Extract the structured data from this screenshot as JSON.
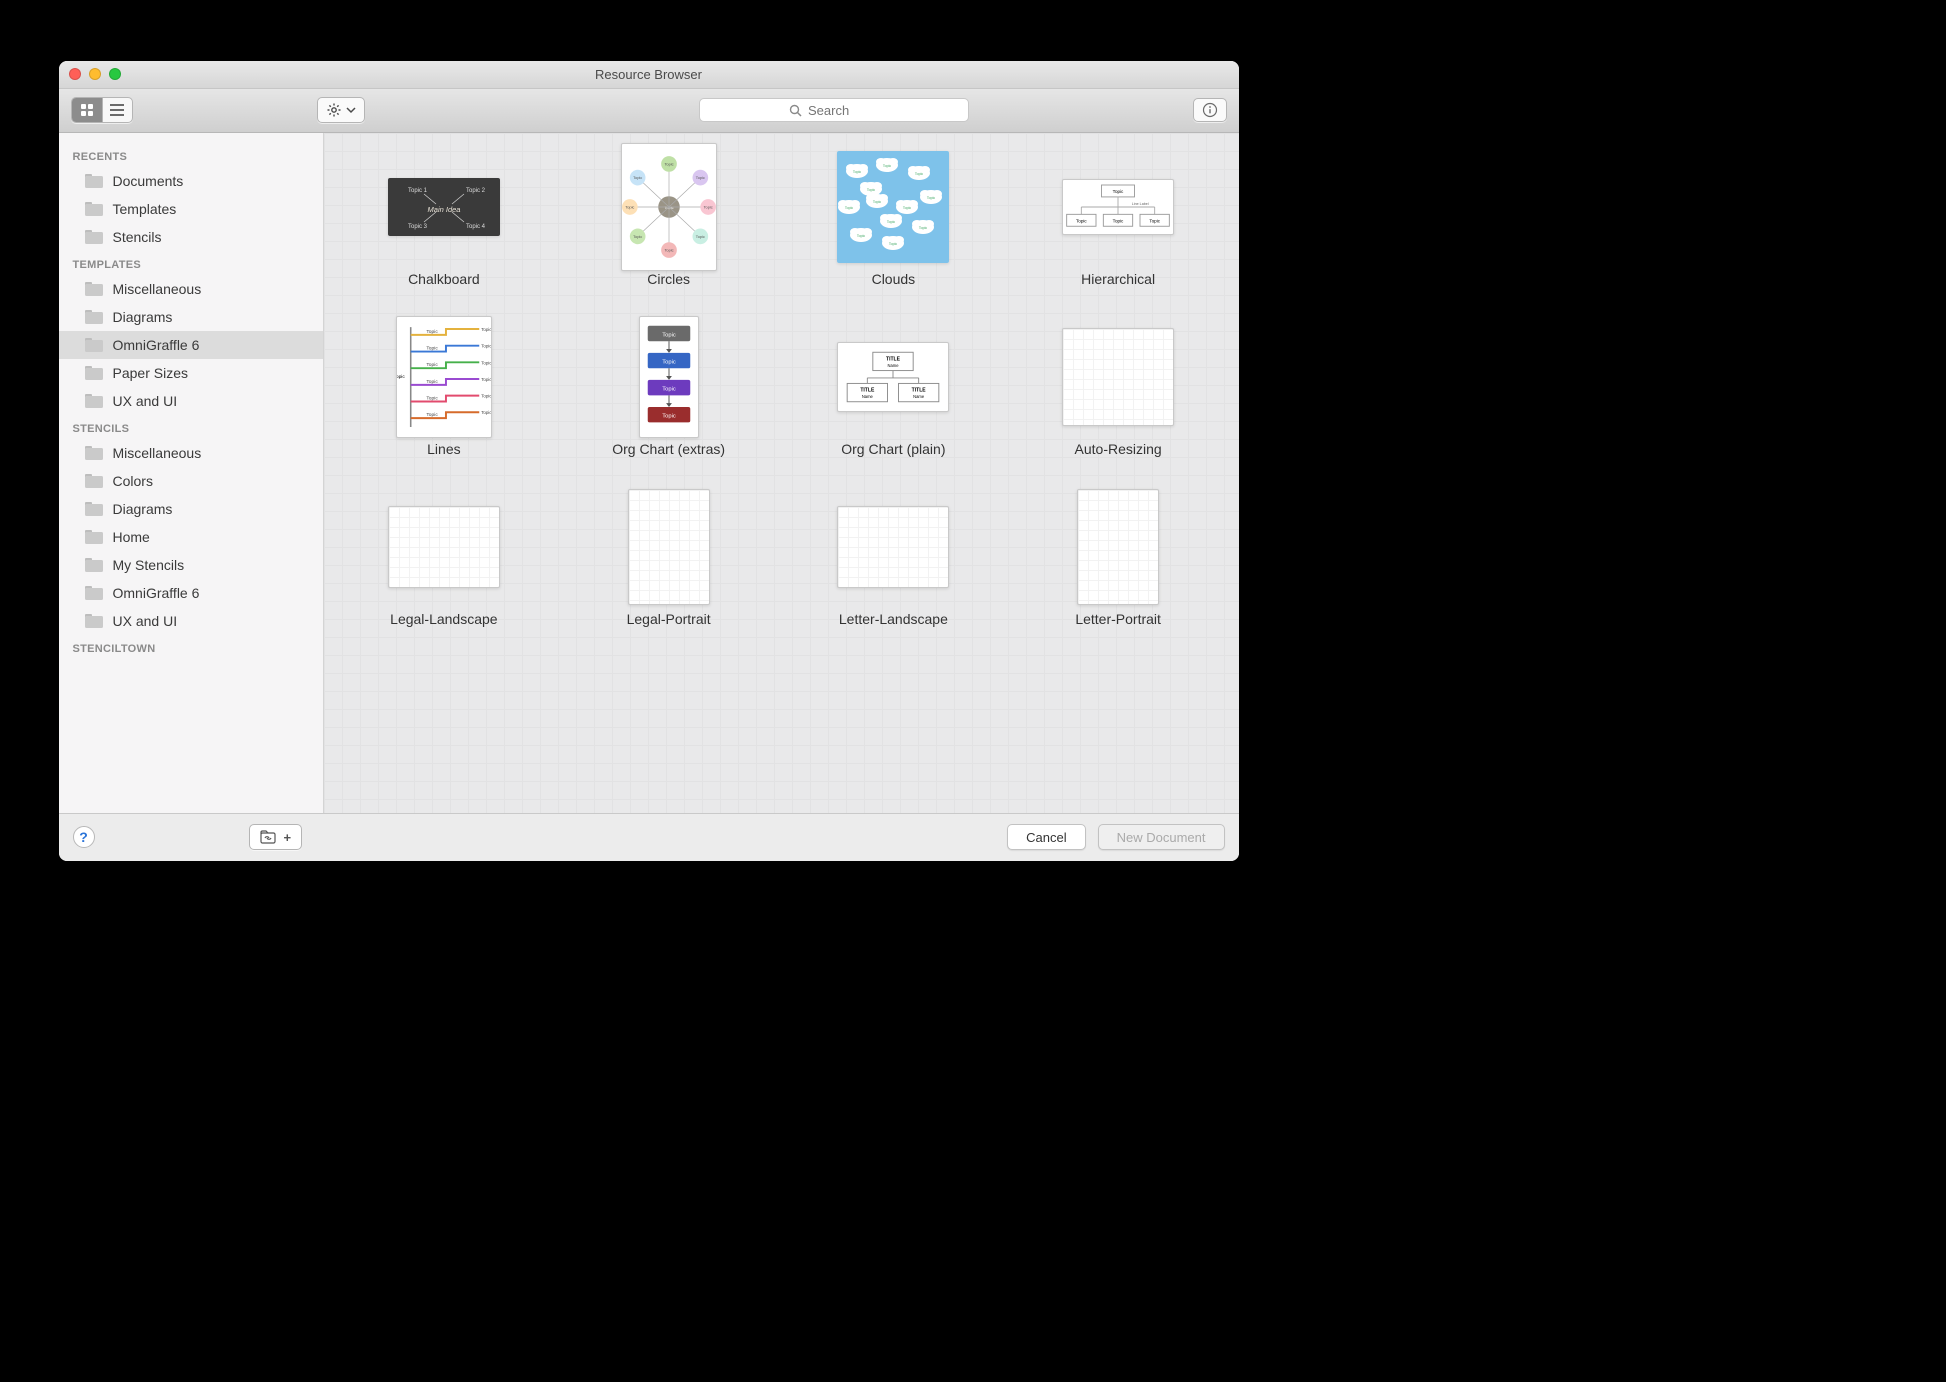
{
  "window": {
    "title": "Resource Browser"
  },
  "toolbar": {
    "search_placeholder": "Search"
  },
  "footer": {
    "cancel_label": "Cancel",
    "new_document_label": "New Document"
  },
  "sidebar": {
    "sections": [
      {
        "header": "RECENTS",
        "items": [
          {
            "label": "Documents"
          },
          {
            "label": "Templates"
          },
          {
            "label": "Stencils"
          }
        ]
      },
      {
        "header": "TEMPLATES",
        "items": [
          {
            "label": "Miscellaneous"
          },
          {
            "label": "Diagrams"
          },
          {
            "label": "OmniGraffle 6",
            "selected": true
          },
          {
            "label": "Paper Sizes"
          },
          {
            "label": "UX and UI"
          }
        ]
      },
      {
        "header": "STENCILS",
        "items": [
          {
            "label": "Miscellaneous"
          },
          {
            "label": "Colors"
          },
          {
            "label": "Diagrams"
          },
          {
            "label": "Home"
          },
          {
            "label": "My Stencils"
          },
          {
            "label": "OmniGraffle 6"
          },
          {
            "label": "UX and UI"
          }
        ]
      },
      {
        "header": "STENCILTOWN",
        "items": []
      }
    ]
  },
  "grid": {
    "items": [
      {
        "label": "Chalkboard",
        "thumb": "chalkboard"
      },
      {
        "label": "Circles",
        "thumb": "circles"
      },
      {
        "label": "Clouds",
        "thumb": "clouds"
      },
      {
        "label": "Hierarchical",
        "thumb": "hierarchical"
      },
      {
        "label": "Lines",
        "thumb": "lines"
      },
      {
        "label": "Org Chart (extras)",
        "thumb": "orgchart-extras"
      },
      {
        "label": "Org Chart (plain)",
        "thumb": "orgchart-plain"
      },
      {
        "label": "Auto-Resizing",
        "thumb": "blank-grid"
      },
      {
        "label": "Legal-Landscape",
        "thumb": "blank-grid-landscape"
      },
      {
        "label": "Legal-Portrait",
        "thumb": "blank-grid-portrait"
      },
      {
        "label": "Letter-Landscape",
        "thumb": "blank-grid-landscape"
      },
      {
        "label": "Letter-Portrait",
        "thumb": "blank-grid-portrait"
      }
    ]
  },
  "chalkboard": {
    "title_text": "Main Idea",
    "corners": [
      "Topic 1",
      "Topic 2",
      "Topic 3",
      "Topic 4"
    ]
  },
  "orgchart_extras": {
    "box_label": "Topic"
  },
  "orgchart_plain": {
    "title": "TITLE",
    "name": "Name"
  },
  "hierarchical": {
    "top": "Topic",
    "link": "Line Label",
    "box": "Topic"
  },
  "lines_topic": "Topic"
}
